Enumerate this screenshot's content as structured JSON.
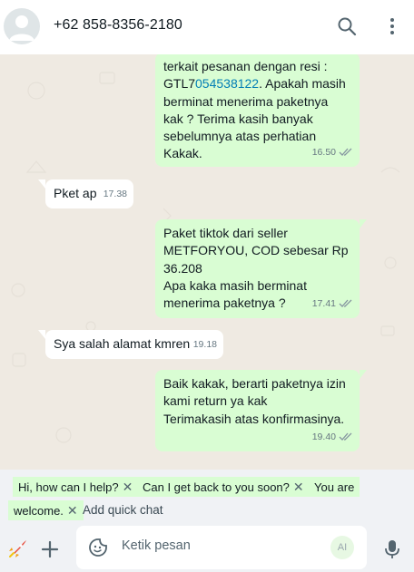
{
  "header": {
    "contact_name": "+62 858-8356-2180",
    "icons": [
      "avatar",
      "search-icon",
      "more-vertical-icon"
    ]
  },
  "messages": [
    {
      "direction": "out",
      "text_before": "terkait pesanan dengan resi :\nGTL7",
      "link": "054538122",
      "text_after": ". Apakah masih\nberminat menerima paketnya\nkak ? Terima kasih banyak\nsebelumnya atas perhatian\nKakak.",
      "time": "16.50",
      "ticks": "read"
    },
    {
      "direction": "in",
      "text": "Pket ap",
      "time": "17.38"
    },
    {
      "direction": "out",
      "text": "Paket tiktok dari seller\nMETFORYOU, COD sebesar Rp\n36.208\nApa kaka masih berminat\nmenerima paketnya ?",
      "time": "17.41",
      "ticks": "read"
    },
    {
      "direction": "in",
      "text": "Sya salah alamat kmren",
      "time": "19.18"
    },
    {
      "direction": "out",
      "text": "Baik kakak, berarti paketnya izin\nkami return ya kak\nTerimakasih atas konfirmasinya.",
      "time": "19.40",
      "ticks": "read"
    }
  ],
  "quick_chats": [
    {
      "label": "Hi, how can I help?"
    },
    {
      "label": "Can I get back to you soon?"
    },
    {
      "label": "You are"
    },
    {
      "label": "welcome."
    }
  ],
  "add_quick_chat": "Add quick chat",
  "composer": {
    "placeholder": "Ketik pesan",
    "ai_label": "AI",
    "icons": [
      "rocket-icon",
      "plus-icon",
      "sticker-icon",
      "mic-icon"
    ]
  },
  "colors": {
    "outgoing_bubble": "#d9fdd3",
    "incoming_bubble": "#ffffff",
    "chat_background": "#efeae2",
    "link": "#027eb5",
    "tick": "#8696a0"
  }
}
